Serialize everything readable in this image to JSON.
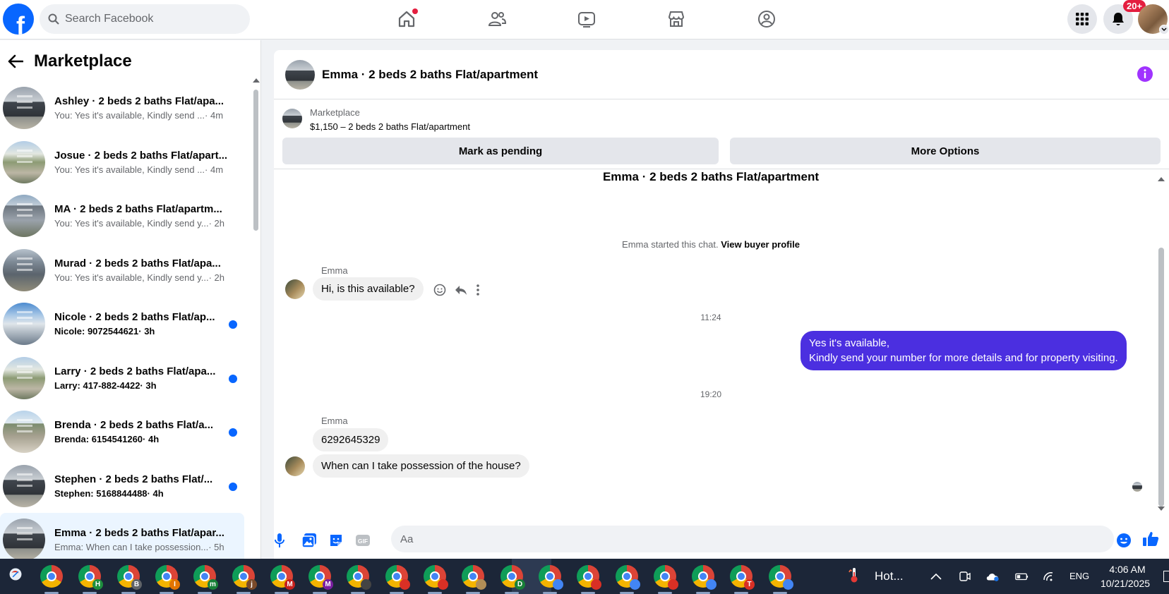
{
  "search": {
    "placeholder": "Search Facebook"
  },
  "notifications": {
    "badge": "20+"
  },
  "sidebar": {
    "title": "Marketplace",
    "conversations": [
      {
        "title": "Ashley · 2 beds 2 baths Flat/apa...",
        "message": "You: Yes it's available, Kindly send ...",
        "time": " · 4m",
        "unread": false,
        "thumb": "bldg-a"
      },
      {
        "title": "Josue · 2 beds 2 baths Flat/apart...",
        "message": "You: Yes it's available, Kindly send ...",
        "time": " · 4m",
        "unread": false,
        "thumb": "bldg-f"
      },
      {
        "title": "MA · 2 beds 2 baths Flat/apartm...",
        "message": "You: Yes it's available, Kindly send y...",
        "time": " · 2h",
        "unread": false,
        "thumb": "bldg-c"
      },
      {
        "title": "Murad · 2 beds 2 baths Flat/apa...",
        "message": "You: Yes it's available, Kindly send y...",
        "time": " · 2h",
        "unread": false,
        "thumb": "bldg-d"
      },
      {
        "title": "Nicole · 2 beds 2 baths Flat/ap...",
        "message": "Nicole: 9072544621",
        "time": " · 3h",
        "unread": true,
        "thumb": "bldg-e"
      },
      {
        "title": "Larry · 2 beds 2 baths Flat/apa...",
        "message": "Larry: 417-882-4422",
        "time": " · 3h",
        "unread": true,
        "thumb": "bldg-f"
      },
      {
        "title": "Brenda · 2 beds 2 baths Flat/a...",
        "message": "Brenda: 6154541260",
        "time": " · 4h",
        "unread": true,
        "thumb": "bldg-b"
      },
      {
        "title": "Stephen · 2 beds 2 baths Flat/...",
        "message": "Stephen: 5168844488",
        "time": " · 4h",
        "unread": true,
        "thumb": "bldg-a"
      },
      {
        "title": "Emma · 2 beds 2 baths Flat/apar...",
        "message": "Emma: When can I take possession...",
        "time": " · 5h",
        "unread": false,
        "thumb": "bldg-a"
      }
    ]
  },
  "chat": {
    "header_title": "Emma · 2 beds 2 baths Flat/apartment",
    "listing_source": "Marketplace",
    "listing_name": "$1,150 – 2 beds 2 baths Flat/apartment",
    "btn_pending": "Mark as pending",
    "btn_more": "More Options",
    "convo_title": "Emma · 2 beds 2 baths Flat/apartment",
    "started_text": "Emma started this chat. ",
    "started_link": "View buyer profile",
    "sender": "Emma",
    "msg1": "Hi, is this available?",
    "time1": "11:24",
    "reply_line1": "Yes it's available,",
    "reply_line2": "Kindly send your number for more details and for property visiting.",
    "time2": "19:20",
    "msg2": "6292645329",
    "msg3": "When can I take possession of the house?",
    "composer_placeholder": "Aa"
  },
  "taskbar": {
    "weather": "Hot...",
    "lang": "ENG",
    "time": "4:06 AM",
    "date": "10/21/2025",
    "apps": [
      {
        "letter": "",
        "color": ""
      },
      {
        "letter": "H",
        "color": "#1e8e3e"
      },
      {
        "letter": "B",
        "color": "#5f6368"
      },
      {
        "letter": "I",
        "color": "#e37400"
      },
      {
        "letter": "m",
        "color": "#188038"
      },
      {
        "letter": "j",
        "color": "#7a4a2a"
      },
      {
        "letter": "M",
        "color": "#c5221f"
      },
      {
        "letter": "M",
        "color": "#7b1fa2"
      },
      {
        "letter": "",
        "color": "#444"
      },
      {
        "letter": "",
        "color": "#d93025"
      },
      {
        "letter": "",
        "color": "#d93025"
      },
      {
        "letter": "",
        "color": "#b08d57"
      },
      {
        "letter": "D",
        "color": "#188038"
      },
      {
        "letter": "",
        "color": "#4285f4"
      },
      {
        "letter": "",
        "color": "#d93025"
      },
      {
        "letter": "",
        "color": "#4285f4"
      },
      {
        "letter": "",
        "color": "#d93025"
      },
      {
        "letter": "",
        "color": "#4285f4"
      },
      {
        "letter": "T",
        "color": "#d93025"
      },
      {
        "letter": "",
        "color": "#4285f4"
      }
    ]
  },
  "colors": {
    "brand": "#0866ff",
    "outgoing_bubble": "#4b2fe0",
    "unread_dot": "#0866ff",
    "badge": "#e41e3f",
    "info": "#a033ff"
  }
}
